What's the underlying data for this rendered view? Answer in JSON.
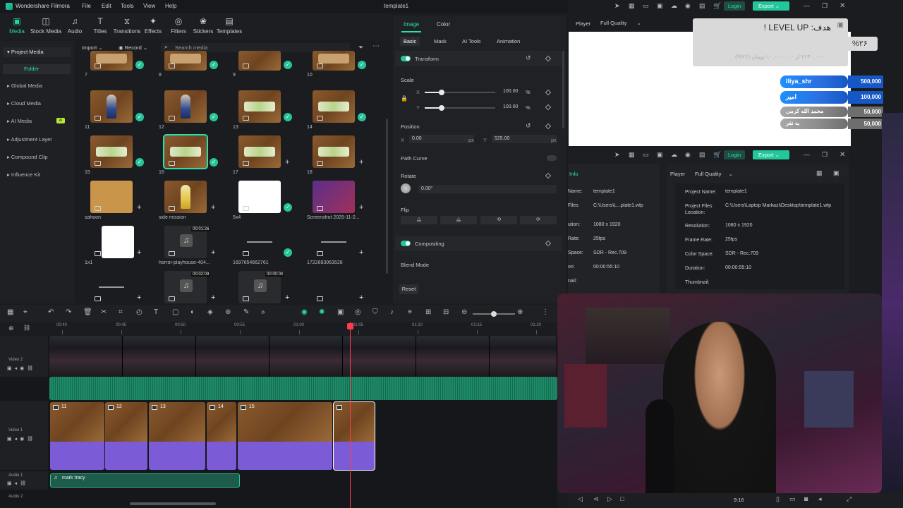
{
  "app": {
    "name": "Wondershare Filmora",
    "project": "template1",
    "menu": [
      "File",
      "Edit",
      "Tools",
      "View",
      "Help"
    ],
    "login": "Login",
    "export": "Export"
  },
  "toolbar": [
    {
      "label": "Media",
      "icon": "media-icon",
      "active": true
    },
    {
      "label": "Stock Media",
      "icon": "stock-icon"
    },
    {
      "label": "Audio",
      "icon": "music-icon"
    },
    {
      "label": "Titles",
      "icon": "titles-icon"
    },
    {
      "label": "Transitions",
      "icon": "transitions-icon"
    },
    {
      "label": "Effects",
      "icon": "effects-icon"
    },
    {
      "label": "Filters",
      "icon": "filters-icon"
    },
    {
      "label": "Stickers",
      "icon": "stickers-icon"
    },
    {
      "label": "Templates",
      "icon": "templates-icon"
    }
  ],
  "sidebar": {
    "items": [
      "Project Media",
      "Folder",
      "Global Media",
      "Cloud Media",
      "AI Media",
      "Adjustment Layer",
      "Compound Clip",
      "Influence Kit"
    ],
    "ai_badge": "AI"
  },
  "media_bar": {
    "import": "Import",
    "record": "Record",
    "search_placeholder": "Search media"
  },
  "media": [
    {
      "label": "7"
    },
    {
      "label": "8"
    },
    {
      "label": "9"
    },
    {
      "label": "10"
    },
    {
      "label": "11"
    },
    {
      "label": "12"
    },
    {
      "label": "13"
    },
    {
      "label": "14"
    },
    {
      "label": "15"
    },
    {
      "label": "16"
    },
    {
      "label": "17"
    },
    {
      "label": "18"
    },
    {
      "label": "sahoon"
    },
    {
      "label": "side mission"
    },
    {
      "label": "5x4"
    },
    {
      "label": "Screenshot 2025-11-2..."
    },
    {
      "label": "1x1"
    },
    {
      "label": "horror-playhouse-404...",
      "duration": "00:01:26"
    },
    {
      "label": "1697654662761"
    },
    {
      "label": "1722693063528"
    },
    {
      "label": ""
    },
    {
      "label": "",
      "duration": "00:02:09"
    },
    {
      "label": "",
      "duration": "00:00:00"
    },
    {
      "label": ""
    }
  ],
  "props": {
    "tabs": [
      "Image",
      "Color"
    ],
    "subtabs": [
      "Basic",
      "Mask",
      "AI Tools",
      "Animation"
    ],
    "transform": "Transform",
    "scale": "Scale",
    "x": "X",
    "y": "Y",
    "scale_x": "100.00",
    "scale_y": "100.00",
    "pct": "%",
    "position": "Position",
    "pos_x": "0.00",
    "pos_y": "525.00",
    "px": "px",
    "path_curve": "Path Curve",
    "rotate": "Rotate",
    "rotate_val": "0.00°",
    "flip": "Flip",
    "compositing": "Compositing",
    "blend_mode": "Blend Mode",
    "reset": "Reset"
  },
  "player": {
    "label": "Player",
    "quality": "Full Quality"
  },
  "overlay": {
    "goal": "هدف: LEVEL UP !",
    "percent": "%۲۶",
    "progress": "۲۶۴۰,۰۰۰ از ۱۰,۰۰۰,۰۰۰ تومان (۲۶%)",
    "progress_fraction": 0.26,
    "donors": [
      {
        "name": "Iliya_shr",
        "amount": "500,000",
        "color": "#1e90ff"
      },
      {
        "name": "امیر",
        "amount": "100,000",
        "color": "#1e90ff"
      },
      {
        "name": "محمد الله کرمی",
        "amount": "50,000",
        "color": "#9a9a9a"
      },
      {
        "name": "به نفر",
        "amount": "50,000",
        "color": "#9a9a9a"
      }
    ]
  },
  "info": {
    "tab": "Info",
    "rows": [
      {
        "k": "Name:",
        "v": "template1"
      },
      {
        "k": "Files",
        "v": "C:\\Users\\L...plate1.wfp"
      },
      {
        "k": "ution:",
        "v": "1080 x 1920"
      },
      {
        "k": "Rate:",
        "v": "25fps"
      },
      {
        "k": "Space:",
        "v": "SDR - Rec.709"
      },
      {
        "k": "on:",
        "v": "00:00:55:10"
      },
      {
        "k": "nail:",
        "v": ""
      }
    ]
  },
  "info2": {
    "rows": [
      {
        "k": "Project Name:",
        "v": "template1"
      },
      {
        "k": "Project Files Location:",
        "v": "C:\\Users\\Laptop Markazi\\Desktop\\template1.wfp"
      },
      {
        "k": "Resolution:",
        "v": "1080 x 1920"
      },
      {
        "k": "Frame Rate:",
        "v": "25fps"
      },
      {
        "k": "Color Space:",
        "v": "SDR - Rec.709"
      },
      {
        "k": "Duration:",
        "v": "00:00:55:10"
      },
      {
        "k": "Thumbnail:",
        "v": ""
      }
    ]
  },
  "ruler": [
    "00:40",
    "00:45",
    "00:50",
    "00:55",
    "01:00",
    "01:05",
    "01:10",
    "01:15",
    "01:20"
  ],
  "tracks": {
    "video2": "Video 2",
    "video1": "Video 1",
    "audio1": "Audio 1",
    "audio2": "Audio 2",
    "clips": [
      "11",
      "12",
      "13",
      "14",
      "15"
    ],
    "audio_clip": "mark tracy"
  },
  "bottom": {
    "ratio": "9:16"
  }
}
